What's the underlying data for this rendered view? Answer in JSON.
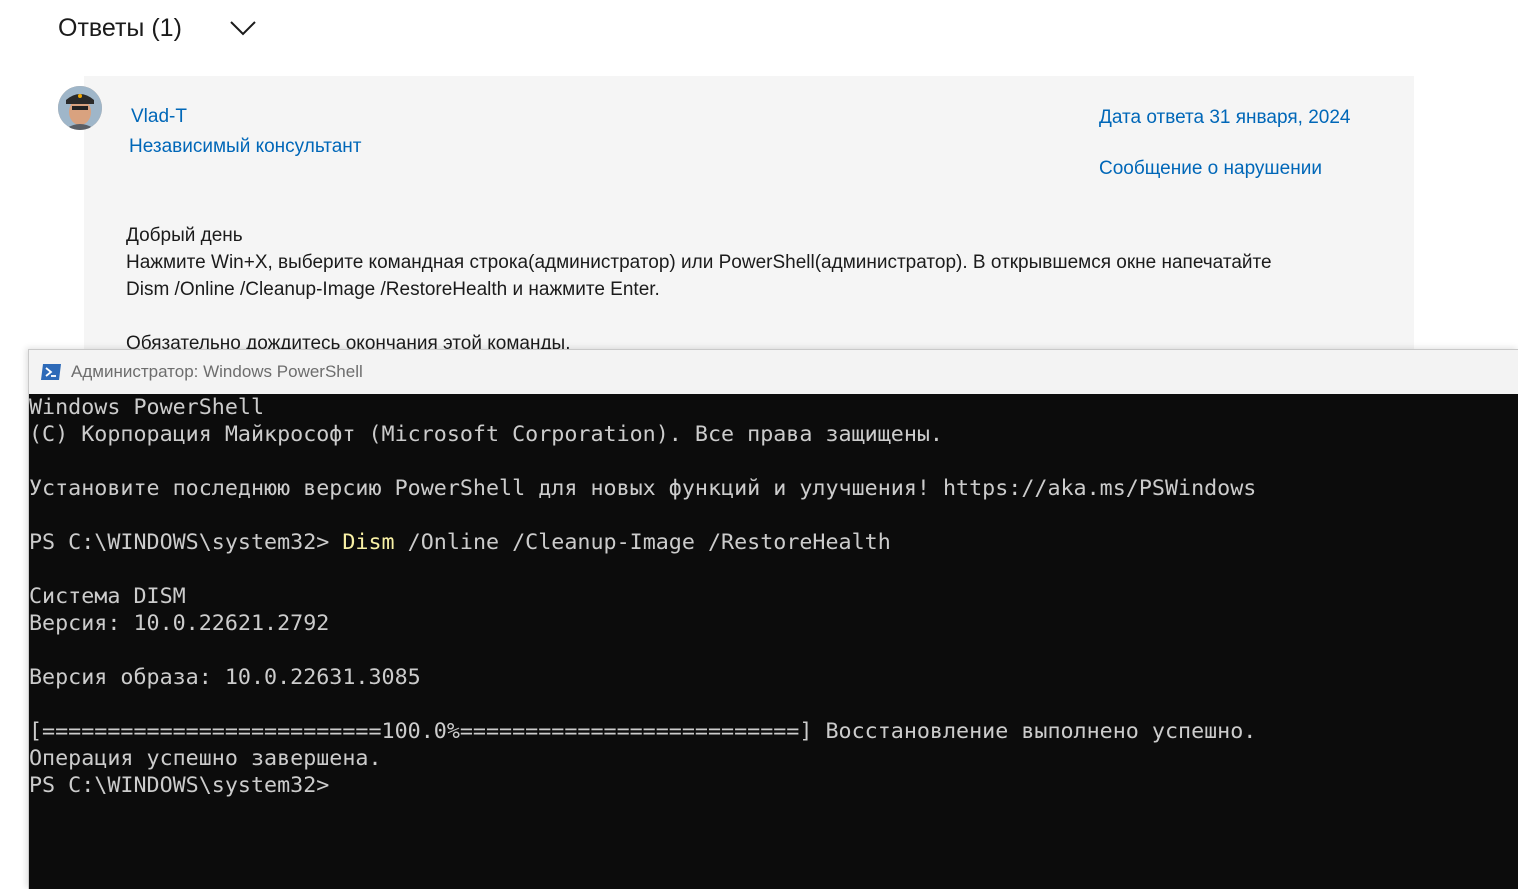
{
  "answers_header": {
    "title": "Ответы (1)"
  },
  "answer": {
    "author": "Vlad-T",
    "role": "Независимый консультант",
    "date": "Дата ответа 31 января, 2024",
    "report_link": "Сообщение о нарушении",
    "body": {
      "greeting": "Добрый день",
      "instruction_line1": "Нажмите Win+X, выберите командная строка(администратор) или PowerShell(администратор). В открывшемся окне напечатайте",
      "instruction_line2": "Dism /Online /Cleanup-Image /RestoreHealth и нажмите Enter.",
      "note": "Обязательно дождитесь окончания этой команды."
    }
  },
  "powershell_window": {
    "title": "Администратор: Windows PowerShell",
    "lines": {
      "l1": "Windows PowerShell",
      "l2": "(C) Корпорация Майкрософт (Microsoft Corporation). Все права защищены.",
      "l3": "Установите последнюю версию PowerShell для новых функций и улучшения! https://aka.ms/PSWindows",
      "prompt": "PS C:\\WINDOWS\\system32> ",
      "cmd_keyword": "Dism",
      "cmd_args": " /Online /Cleanup-Image /RestoreHealth",
      "l5": "Система DISM",
      "l6": "Версия: 10.0.22621.2792",
      "l7": "Версия образа: 10.0.22631.3085",
      "l8": "[==========================100.0%==========================] Восстановление выполнено успешно.",
      "l9": "Операция успешно завершена.",
      "l10": "PS C:\\WINDOWS\\system32>"
    },
    "colors": {
      "background": "#0c0c0c",
      "text": "#cccccc",
      "command": "#f9f1a5"
    }
  }
}
